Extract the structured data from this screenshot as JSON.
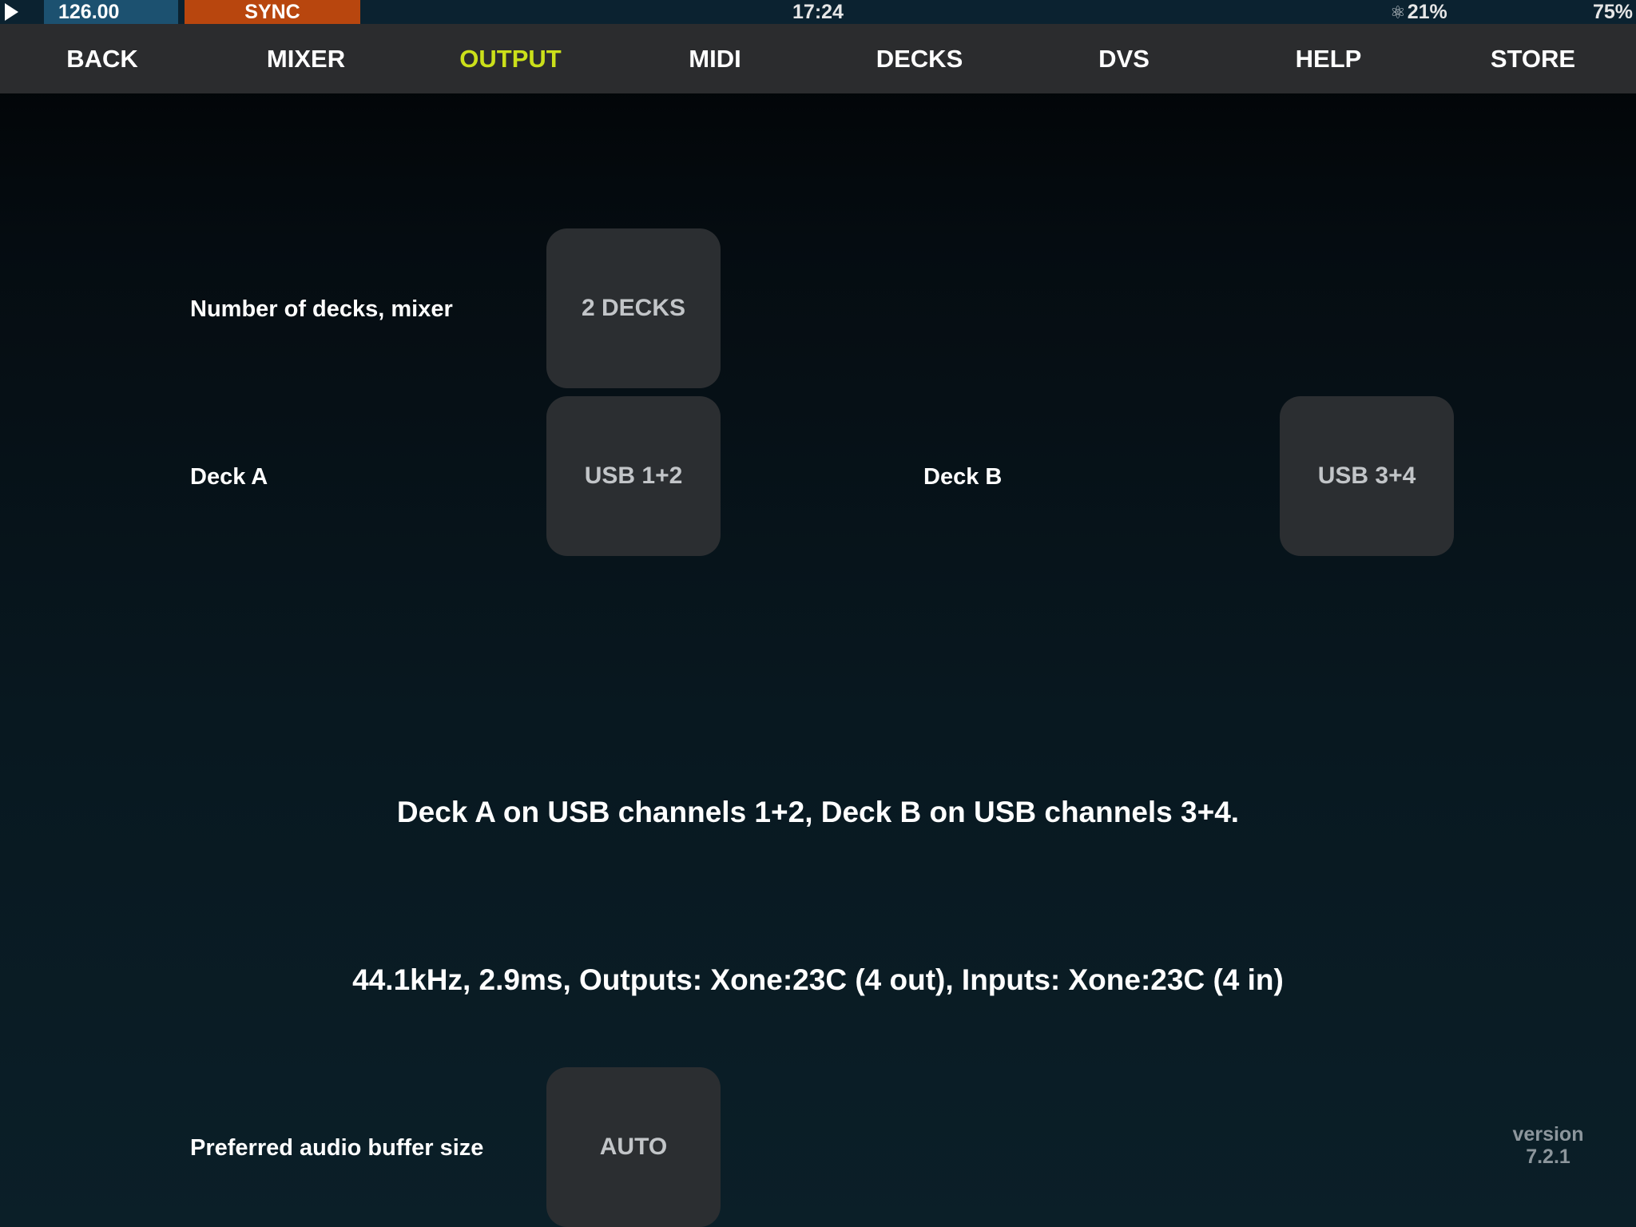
{
  "status_bar": {
    "bpm": "126.00",
    "sync_label": "SYNC",
    "clock": "17:24",
    "cpu_icon": "atom-icon",
    "cpu_load": "21%",
    "battery": "75%",
    "colors": {
      "background": "#0b2230",
      "bpm_box": "#1c5170",
      "sync_box": "#b8460e"
    }
  },
  "nav": {
    "items": [
      {
        "label": "BACK"
      },
      {
        "label": "MIXER"
      },
      {
        "label": "OUTPUT"
      },
      {
        "label": "MIDI"
      },
      {
        "label": "DECKS"
      },
      {
        "label": "DVS"
      },
      {
        "label": "HELP"
      },
      {
        "label": "STORE"
      }
    ],
    "active": "OUTPUT",
    "active_color": "#cbe01a"
  },
  "settings": {
    "decks_mixer": {
      "label": "Number of decks, mixer",
      "value": "2 DECKS"
    },
    "deck_a": {
      "label": "Deck A",
      "value": "USB 1+2"
    },
    "deck_b": {
      "label": "Deck B",
      "value": "USB 3+4"
    },
    "routing_summary": "Deck A on USB channels 1+2, Deck B on USB channels 3+4.",
    "audio_info": "44.1kHz, 2.9ms, Outputs: Xone:23C (4 out), Inputs: Xone:23C (4 in)",
    "buffer_size": {
      "label": "Preferred audio buffer size",
      "value": "AUTO"
    }
  },
  "version": {
    "label": "version",
    "number": "7.2.1"
  }
}
